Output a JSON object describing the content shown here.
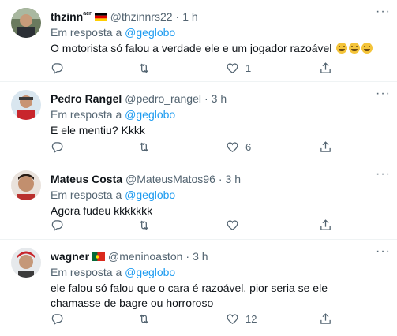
{
  "tweets": [
    {
      "name": "thzinn",
      "name_suffix": "acr",
      "handle": "@thzinnrs22",
      "time": "1 h",
      "reply_prefix": "Em resposta a",
      "reply_to": "@geglobo",
      "text": "O motorista só falou a verdade ele e um jogador razoável",
      "reply_count": "",
      "retweet_count": "",
      "like_count": "1"
    },
    {
      "name": "Pedro Rangel",
      "handle": "@pedro_rangel",
      "time": "3 h",
      "reply_prefix": "Em resposta a",
      "reply_to": "@geglobo",
      "text": "E ele mentiu? Kkkk",
      "reply_count": "",
      "retweet_count": "",
      "like_count": "6"
    },
    {
      "name": "Mateus Costa",
      "handle": "@MateusMatos96",
      "time": "3 h",
      "reply_prefix": "Em resposta a",
      "reply_to": "@geglobo",
      "text": "Agora fudeu kkkkkkk",
      "reply_count": "",
      "retweet_count": "",
      "like_count": ""
    },
    {
      "name": "wagner",
      "handle": "@meninoaston",
      "time": "3 h",
      "reply_prefix": "Em resposta a",
      "reply_to": "@geglobo",
      "text": "ele falou só falou que o cara é razoável, pior seria se ele chamasse de bagre ou horroroso",
      "reply_count": "",
      "retweet_count": "",
      "like_count": "12"
    }
  ],
  "separator": "·",
  "more_glyph": "···",
  "colors": {
    "link": "#1d9bf0",
    "muted": "#536471",
    "text": "#0f1419",
    "divider": "#eff3f4"
  },
  "icons": [
    "reply-icon",
    "retweet-icon",
    "like-icon",
    "share-icon",
    "more-icon",
    "laughing-emoji"
  ]
}
